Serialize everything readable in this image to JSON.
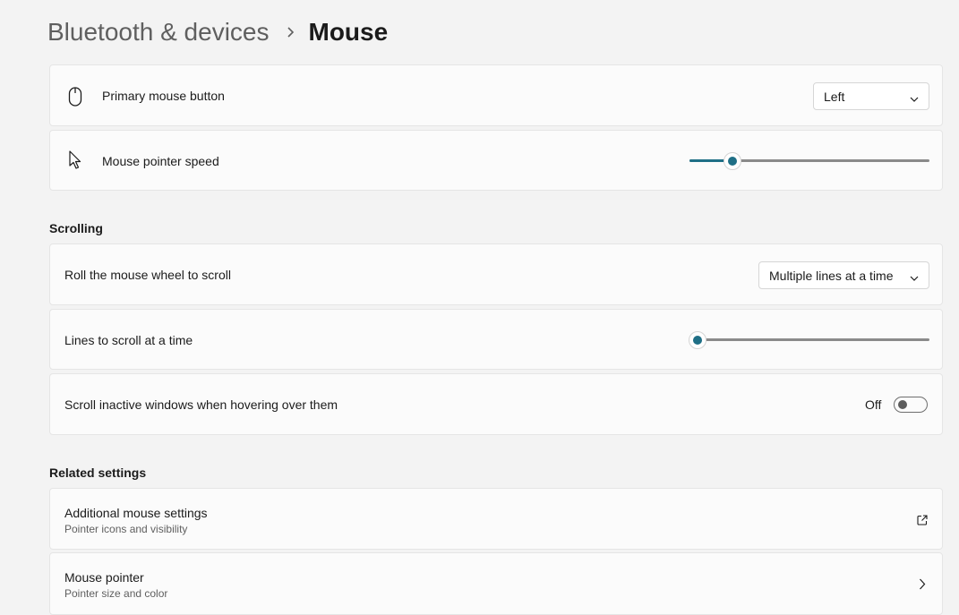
{
  "breadcrumb": {
    "parent": "Bluetooth & devices",
    "current": "Mouse"
  },
  "primary_button": {
    "label": "Primary mouse button",
    "value": "Left",
    "icon": "mouse-icon"
  },
  "pointer_speed": {
    "label": "Mouse pointer speed",
    "icon": "pointer-icon",
    "level": 0.18
  },
  "scrolling": {
    "title": "Scrolling",
    "roll_wheel": {
      "label": "Roll the mouse wheel to scroll",
      "value": "Multiple lines at a time"
    },
    "lines": {
      "label": "Lines to scroll at a time",
      "level": 0.0
    },
    "inactive": {
      "label": "Scroll inactive windows when hovering over them",
      "state": "Off"
    }
  },
  "related": {
    "title": "Related settings",
    "items": [
      {
        "label": "Additional mouse settings",
        "sublabel": "Pointer icons and visibility",
        "icon": "external-link-icon"
      },
      {
        "label": "Mouse pointer",
        "sublabel": "Pointer size and color",
        "icon": "chevron-right-icon"
      }
    ]
  },
  "colors": {
    "accent": "#1f6f86",
    "card": "#fbfbfb",
    "background": "#f3f3f3"
  }
}
